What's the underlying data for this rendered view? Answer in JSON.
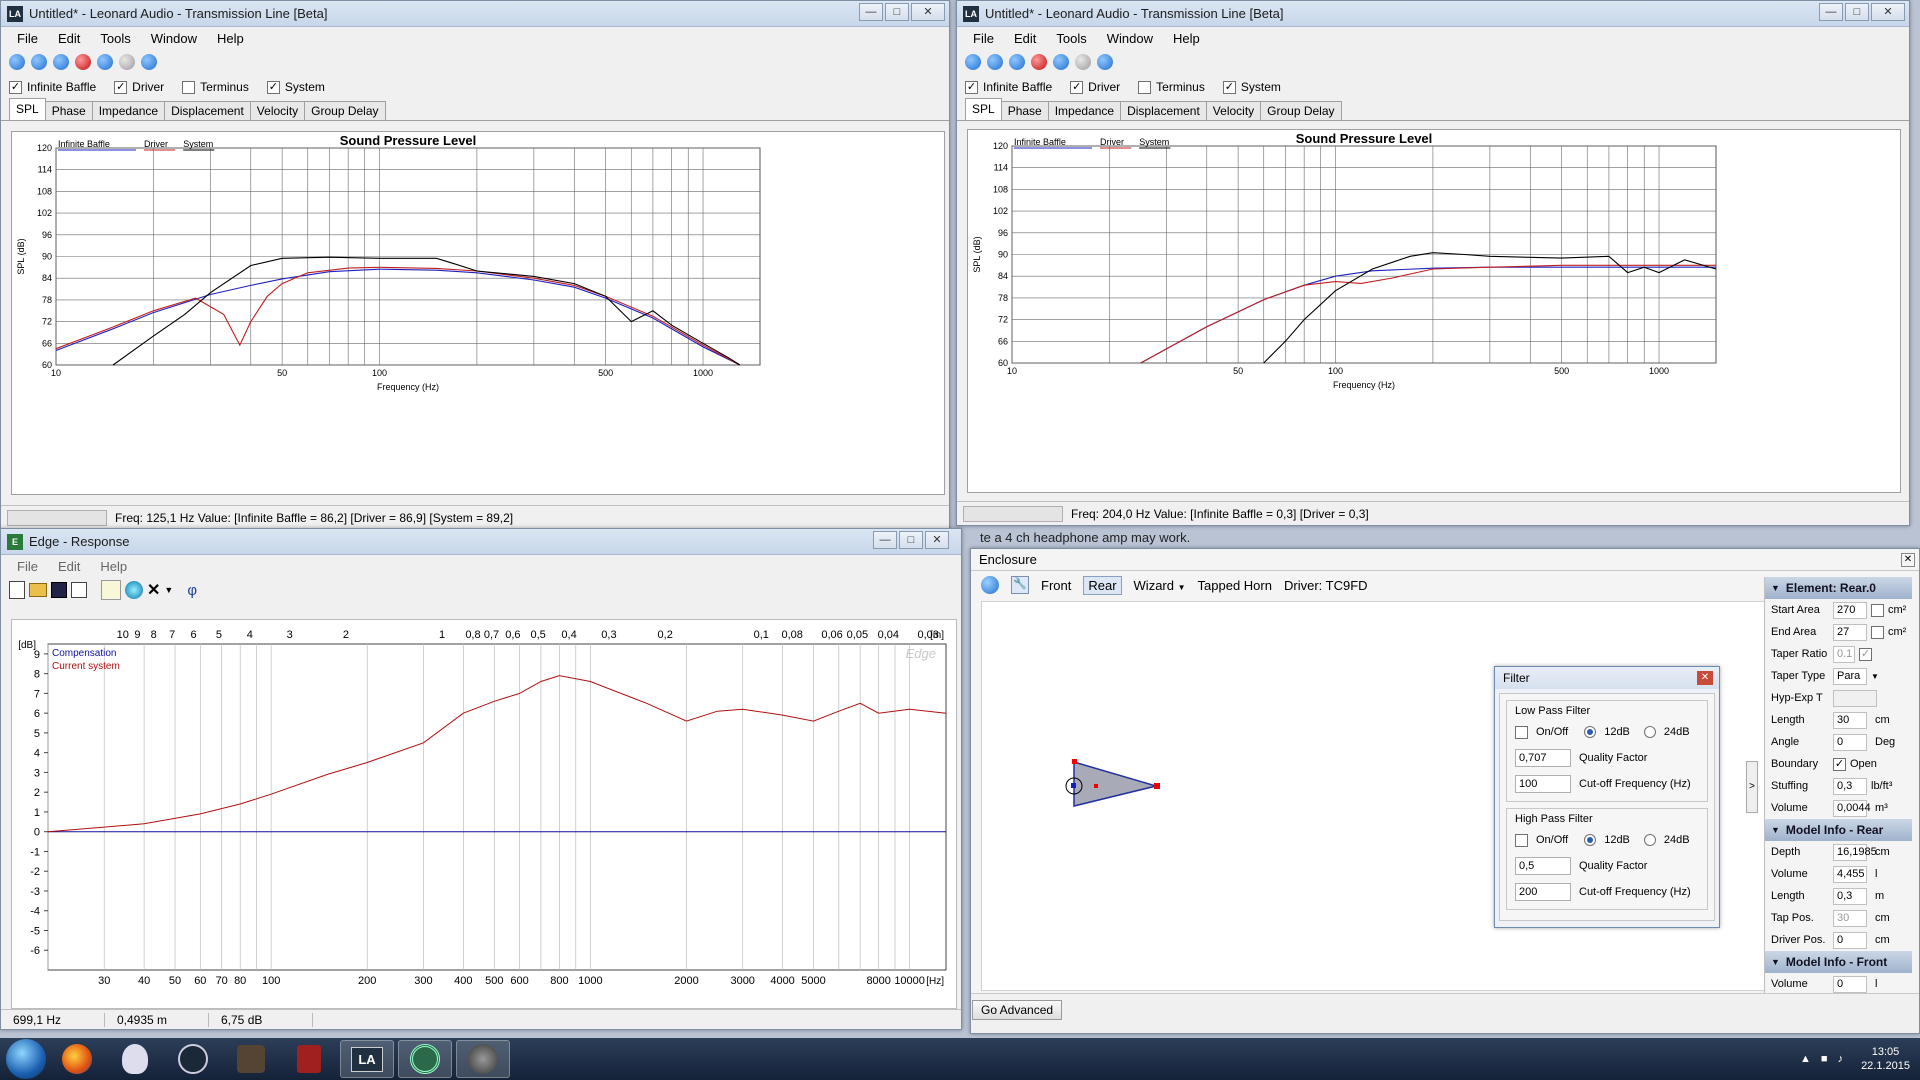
{
  "win1": {
    "title": "Untitled* - Leonard Audio - Transmission Line [Beta]",
    "menu": [
      "File",
      "Edit",
      "Tools",
      "Window",
      "Help"
    ],
    "checks": [
      {
        "label": "Infinite Baffle",
        "checked": true
      },
      {
        "label": "Driver",
        "checked": true
      },
      {
        "label": "Terminus",
        "checked": false
      },
      {
        "label": "System",
        "checked": true
      }
    ],
    "tabs": [
      "SPL",
      "Phase",
      "Impedance",
      "Displacement",
      "Velocity",
      "Group Delay"
    ],
    "active_tab": "SPL",
    "status": "Freq: 125,1 Hz   Value: [Infinite Baffle = 86,2]  [Driver = 86,9]  [System = 89,2]"
  },
  "win2": {
    "title": "Untitled* - Leonard Audio - Transmission Line [Beta]",
    "menu": [
      "File",
      "Edit",
      "Tools",
      "Window",
      "Help"
    ],
    "checks": [
      {
        "label": "Infinite Baffle",
        "checked": true
      },
      {
        "label": "Driver",
        "checked": true
      },
      {
        "label": "Terminus",
        "checked": false
      },
      {
        "label": "System",
        "checked": true
      }
    ],
    "tabs": [
      "SPL",
      "Phase",
      "Impedance",
      "Displacement",
      "Velocity",
      "Group Delay"
    ],
    "active_tab": "SPL",
    "status": "Freq: 204,0 Hz   Value: [Infinite Baffle = 0,3]  [Driver = 0,3]"
  },
  "chart_data": [
    {
      "type": "line",
      "title": "Sound Pressure Level",
      "xlabel": "Frequency (Hz)",
      "ylabel": "SPL (dB)",
      "xscale": "log",
      "xlim": [
        10,
        1500
      ],
      "ylim": [
        60,
        120
      ],
      "yticks": [
        60,
        66,
        72,
        78,
        84,
        90,
        96,
        102,
        108,
        114,
        120
      ],
      "xticks": [
        "10",
        "50",
        "100",
        "500",
        "1000"
      ],
      "legend": [
        "Infinite Baffle",
        "Driver",
        "System"
      ],
      "series": [
        {
          "name": "Infinite Baffle",
          "color": "#2020c0",
          "x": [
            10,
            15,
            20,
            30,
            40,
            50,
            70,
            100,
            150,
            200,
            300,
            400,
            500,
            700,
            1000,
            1300
          ],
          "y": [
            64,
            70,
            74.5,
            79.5,
            82,
            83.8,
            85.8,
            86.5,
            86.2,
            85.5,
            83.5,
            81.5,
            78.5,
            73,
            65,
            60
          ]
        },
        {
          "name": "Driver",
          "color": "#c02020",
          "x": [
            10,
            15,
            20,
            27,
            33,
            37,
            40,
            45,
            50,
            60,
            80,
            100,
            150,
            200,
            300,
            400,
            500,
            700,
            1000,
            1300
          ],
          "y": [
            64.5,
            70.5,
            75,
            78.5,
            74,
            65.5,
            72,
            79,
            82.5,
            85.5,
            86.8,
            87,
            86.7,
            86,
            84,
            82,
            79,
            73.5,
            65.5,
            60
          ]
        },
        {
          "name": "System",
          "color": "#000000",
          "x": [
            15,
            20,
            25,
            30,
            40,
            50,
            70,
            100,
            150,
            170,
            200,
            300,
            400,
            500,
            600,
            700,
            800,
            1000,
            1200,
            1300
          ],
          "y": [
            60,
            68,
            74,
            80,
            87.5,
            89.5,
            89.8,
            89.5,
            89.5,
            88,
            86,
            84.5,
            82.5,
            79,
            72,
            75,
            71,
            66,
            62,
            60
          ]
        }
      ]
    },
    {
      "type": "line",
      "title": "Sound Pressure Level",
      "xlabel": "Frequency (Hz)",
      "ylabel": "SPL (dB)",
      "xscale": "log",
      "xlim": [
        10,
        1500
      ],
      "ylim": [
        60,
        120
      ],
      "yticks": [
        60,
        66,
        72,
        78,
        84,
        90,
        96,
        102,
        108,
        114,
        120
      ],
      "xticks": [
        "10",
        "50",
        "100",
        "500",
        "1000"
      ],
      "legend": [
        "Infinite Baffle",
        "Driver",
        "System"
      ],
      "series": [
        {
          "name": "Infinite Baffle",
          "color": "#2020c0",
          "x": [
            25,
            40,
            60,
            80,
            100,
            130,
            200,
            300,
            500,
            1000,
            1500
          ],
          "y": [
            60,
            70,
            77.5,
            81.5,
            84,
            85.5,
            86.2,
            86.5,
            86.5,
            86.5,
            86.5
          ]
        },
        {
          "name": "Driver",
          "color": "#c02020",
          "x": [
            25,
            40,
            60,
            80,
            100,
            120,
            150,
            200,
            300,
            500,
            1000,
            1500
          ],
          "y": [
            60,
            70,
            77.5,
            81.5,
            82.5,
            82,
            83.5,
            86,
            86.5,
            87,
            87,
            87
          ]
        },
        {
          "name": "System",
          "color": "#000000",
          "x": [
            60,
            70,
            80,
            100,
            130,
            170,
            200,
            250,
            300,
            500,
            700,
            800,
            900,
            1000,
            1200,
            1500
          ],
          "y": [
            60,
            66,
            72,
            80,
            86,
            89.5,
            90.5,
            90,
            89.5,
            89,
            89.5,
            85,
            86.5,
            85,
            88.5,
            86
          ]
        }
      ]
    },
    {
      "type": "line",
      "title": "",
      "xlabel": "[Hz]",
      "ylabel": "[dB]",
      "xscale": "log",
      "xlim": [
        20,
        13000
      ],
      "ylim": [
        -7,
        9.5
      ],
      "yticks": [
        -6,
        -5,
        -4,
        -3,
        -2,
        -1,
        0,
        1,
        2,
        3,
        4,
        5,
        6,
        7,
        8,
        9
      ],
      "xticks": [
        "30",
        "40",
        "50",
        "60",
        "70",
        "80",
        "100",
        "200",
        "300",
        "400",
        "500",
        "600",
        "800",
        "1000",
        "2000",
        "3000",
        "4000",
        "5000",
        "8000",
        "10000"
      ],
      "top_axis_label": "[m]",
      "top_ticks": [
        "10",
        "9",
        "8",
        "7",
        "6",
        "5",
        "4",
        "3",
        "2",
        "1",
        "0,8",
        "0,7",
        "0,6",
        "0,5",
        "0,4",
        "0,3",
        "0,2",
        "0,1",
        "0,08",
        "0,06",
        "0,05",
        "0,04",
        "0,03"
      ],
      "watermark": "Edge",
      "legend": [
        "Compensation",
        "Current system"
      ],
      "series": [
        {
          "name": "Compensation",
          "color": "#1010a0",
          "x": [
            20,
            13000
          ],
          "y": [
            0,
            0
          ]
        },
        {
          "name": "Current system",
          "color": "#b01010",
          "x": [
            20,
            40,
            60,
            80,
            100,
            150,
            200,
            300,
            400,
            500,
            600,
            700,
            800,
            1000,
            1200,
            1500,
            2000,
            2500,
            3000,
            4000,
            5000,
            6000,
            7000,
            8000,
            10000,
            13000
          ],
          "y": [
            0,
            0.4,
            0.9,
            1.4,
            1.9,
            2.9,
            3.5,
            4.5,
            6,
            6.6,
            7,
            7.6,
            7.9,
            7.6,
            7.1,
            6.5,
            5.6,
            6.1,
            6.2,
            5.9,
            5.6,
            6.1,
            6.5,
            6,
            6.2,
            6
          ]
        }
      ]
    }
  ],
  "edge": {
    "title": "Edge - Response",
    "menu": [
      "File",
      "Edit",
      "Help"
    ],
    "status": [
      "699,1 Hz",
      "0,4935 m",
      "6,75 dB"
    ]
  },
  "enclosure": {
    "title": "Enclosure",
    "toolbar": [
      "Front",
      "Rear",
      "Wizard",
      "Tapped Horn",
      "Driver: TC9FD"
    ],
    "button": "Go Advanced",
    "element_head": "Element: Rear.0",
    "element_props": [
      {
        "label": "Start Area",
        "value": "270",
        "unit": "cm²"
      },
      {
        "label": "End Area",
        "value": "27",
        "unit": "cm²"
      },
      {
        "label": "Taper Ratio",
        "value": "0.1",
        "unit": ""
      },
      {
        "label": "Taper Type",
        "value": "Para",
        "unit": ""
      },
      {
        "label": "Hyp-Exp T",
        "value": "",
        "unit": ""
      },
      {
        "label": "Length",
        "value": "30",
        "unit": "cm"
      },
      {
        "label": "Angle",
        "value": "0",
        "unit": "Deg"
      },
      {
        "label": "Boundary",
        "value": "Open",
        "unit": ""
      },
      {
        "label": "Stuffing",
        "value": "0,3",
        "unit": "lb/ft³"
      },
      {
        "label": "Volume",
        "value": "0,0044",
        "unit": "m³"
      }
    ],
    "rear_head": "Model Info - Rear",
    "rear_props": [
      {
        "label": "Depth",
        "value": "16,1985",
        "unit": "cm"
      },
      {
        "label": "Volume",
        "value": "4,455",
        "unit": "l"
      },
      {
        "label": "Length",
        "value": "0,3",
        "unit": "m"
      },
      {
        "label": "Tap Pos.",
        "value": "30",
        "unit": "cm"
      },
      {
        "label": "Driver Pos.",
        "value": "0",
        "unit": "cm"
      }
    ],
    "front_head": "Model Info - Front",
    "front_props": [
      {
        "label": "Volume",
        "value": "0",
        "unit": "l"
      }
    ]
  },
  "filter": {
    "title": "Filter",
    "low": {
      "group": "Low Pass Filter",
      "onoff": "On/Off",
      "db12": "12dB",
      "db24": "24dB",
      "q_val": "0,707",
      "q_label": "Quality Factor",
      "fc_val": "100",
      "fc_label": "Cut-off Frequency (Hz)"
    },
    "high": {
      "group": "High Pass Filter",
      "onoff": "On/Off",
      "db12": "12dB",
      "db24": "24dB",
      "q_val": "0,5",
      "q_label": "Quality Factor",
      "fc_val": "200",
      "fc_label": "Cut-off Frequency (Hz)"
    }
  },
  "background_text": "te a 4 ch headphone amp may work.",
  "clock": {
    "time": "13:05",
    "date": "22.1.2015"
  },
  "taskbar_apps": [
    "start-orb",
    "firefox",
    "alien",
    "steam",
    "app4",
    "app5",
    "app6",
    "leonard-audio",
    "edge",
    "app9"
  ]
}
